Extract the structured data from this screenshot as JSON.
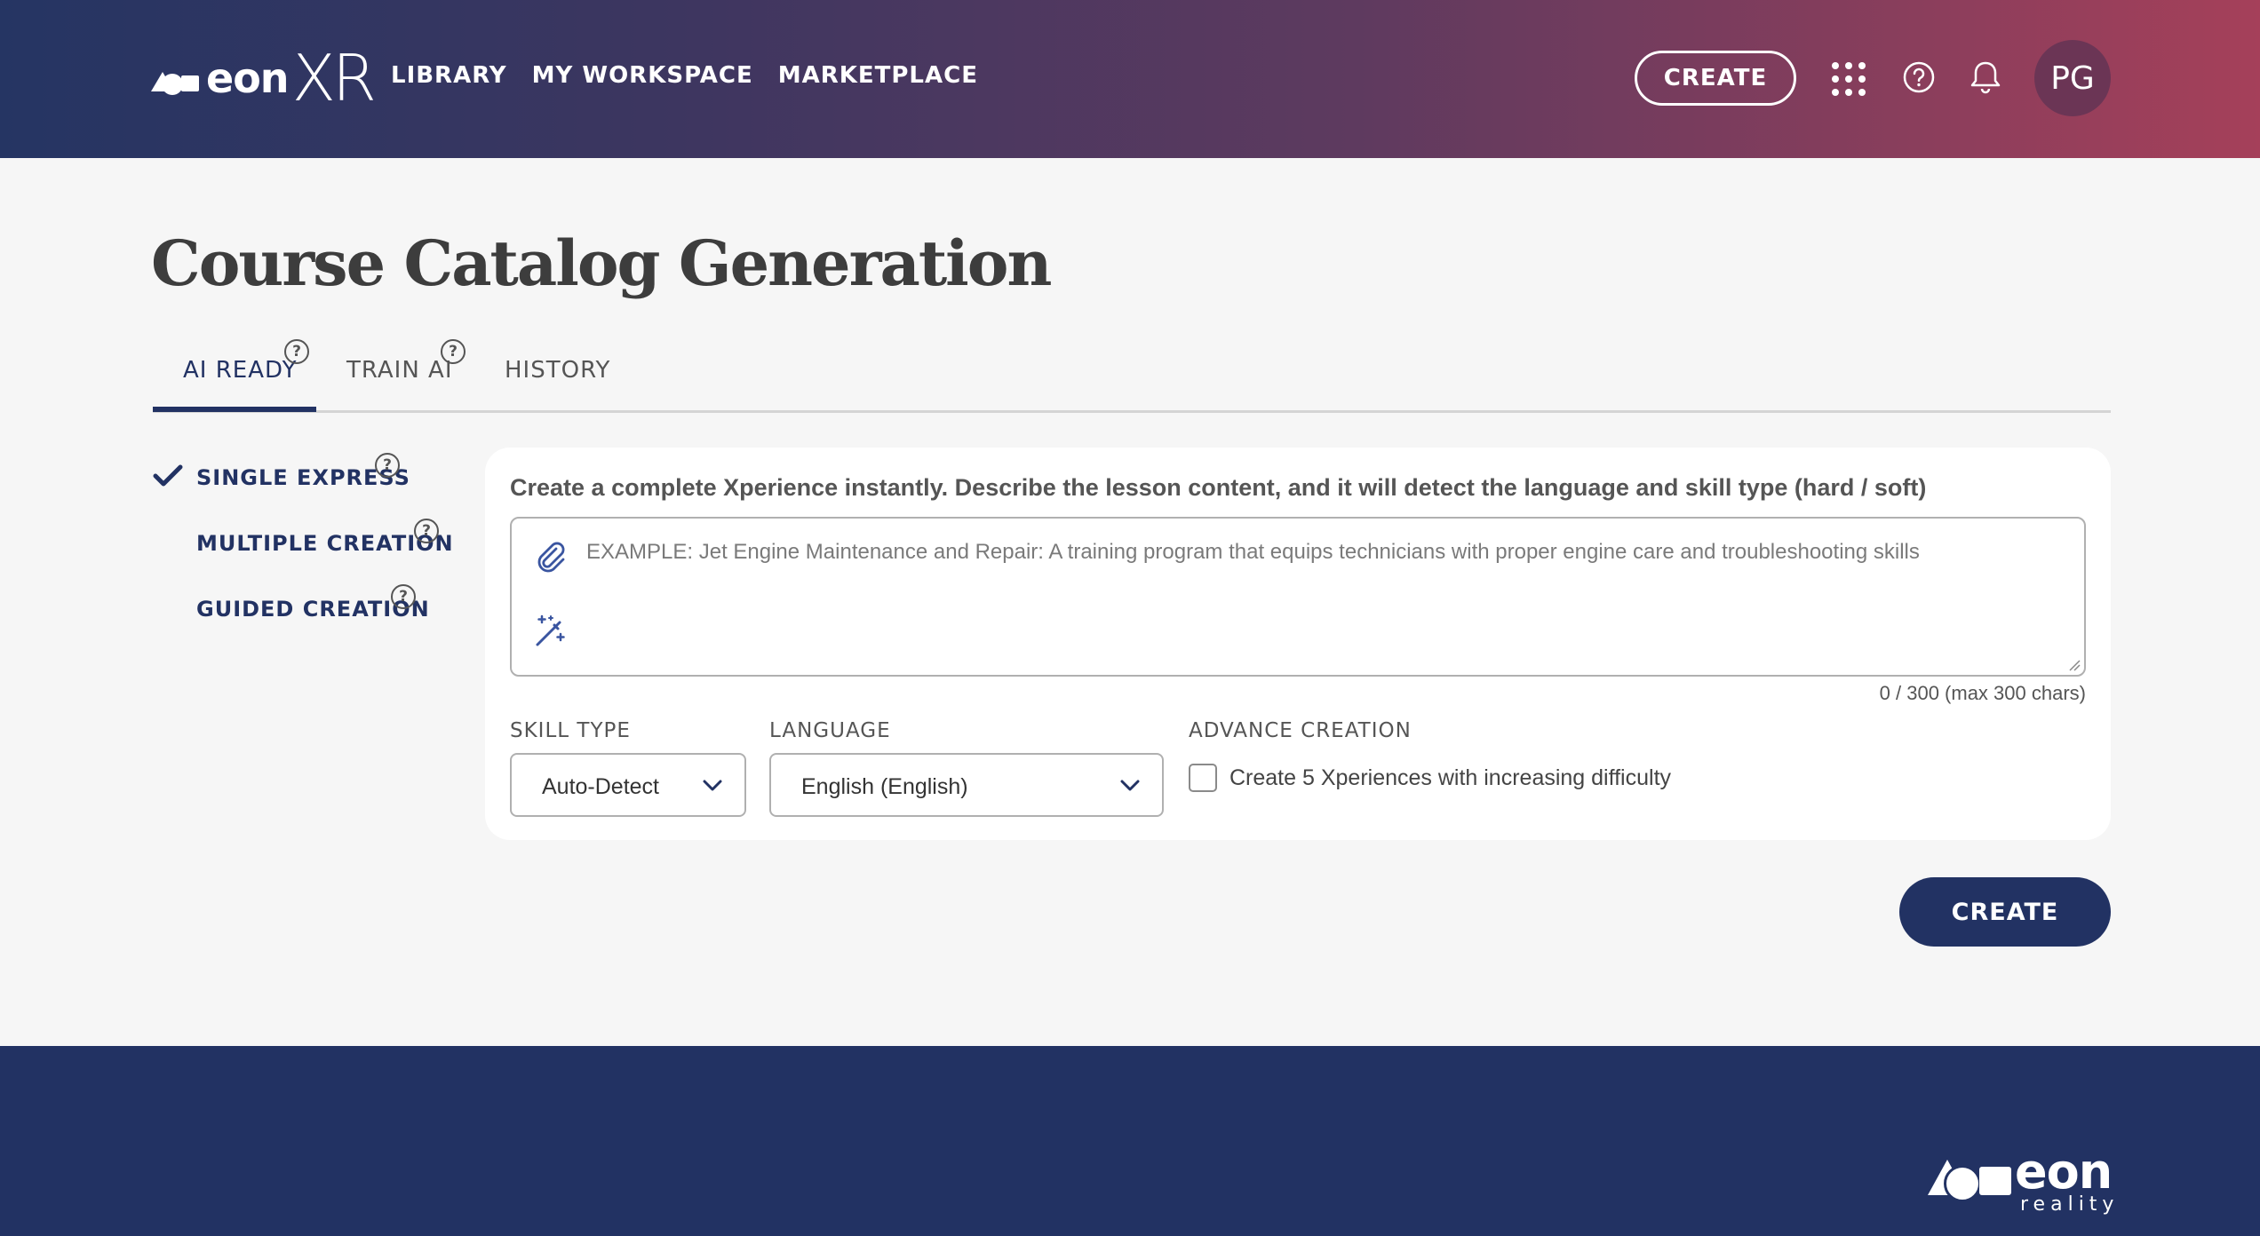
{
  "header": {
    "logo_text": "eon",
    "logo_text_xr": "XR",
    "nav": [
      "LIBRARY",
      "MY WORKSPACE",
      "MARKETPLACE"
    ],
    "create_label": "CREATE",
    "avatar_initials": "PG"
  },
  "page": {
    "title": "Course Catalog Generation"
  },
  "tabs": [
    {
      "label": "AI READY",
      "active": true,
      "help": "?"
    },
    {
      "label": "TRAIN AI",
      "active": false,
      "help": "?"
    },
    {
      "label": "HISTORY",
      "active": false
    }
  ],
  "modes": [
    {
      "label": "SINGLE EXPRESS",
      "selected": true,
      "help": "?"
    },
    {
      "label": "MULTIPLE CREATION",
      "selected": false,
      "help": "?"
    },
    {
      "label": "GUIDED CREATION",
      "selected": false,
      "help": "?"
    }
  ],
  "form": {
    "description": "Create a complete Xperience instantly. Describe the lesson content, and it will detect the language and skill type (hard / soft)",
    "prompt_value": "",
    "prompt_placeholder": "EXAMPLE: Jet Engine Maintenance and Repair: A training program that equips technicians with proper engine care and troubleshooting skills",
    "char_count": "0 / 300 (max 300 chars)",
    "skill_type_label": "SKILL TYPE",
    "skill_type_value": "Auto-Detect",
    "language_label": "LANGUAGE",
    "language_value": "English (English)",
    "advance_label": "ADVANCE CREATION",
    "advance_checkbox_label": "Create 5 Xperiences with increasing difficulty",
    "advance_checked": false,
    "create_label": "CREATE"
  },
  "footer": {
    "logo_text": "eon",
    "logo_subtext": "reality"
  },
  "colors": {
    "brand_navy": "#223263",
    "header_gradient_start": "#253563",
    "header_gradient_end": "#a5405a",
    "avatar_bg": "#6b3555"
  }
}
